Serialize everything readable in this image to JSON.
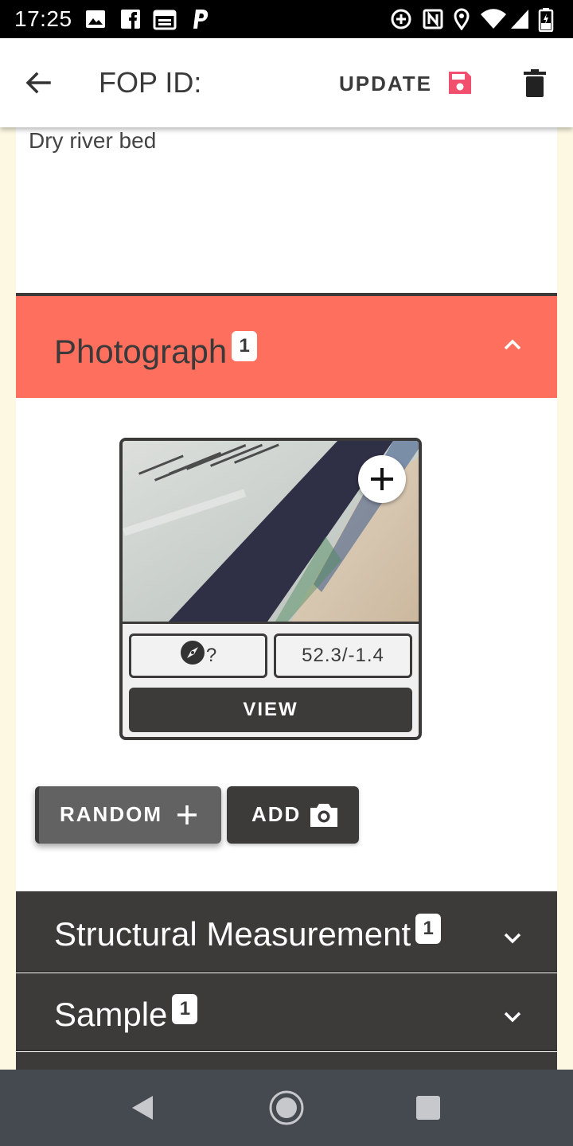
{
  "status_bar": {
    "time": "17:25",
    "left_icons": [
      "image-icon",
      "facebook-icon",
      "calendar-icon",
      "parking-icon"
    ],
    "right_icons": [
      "data-saver-icon",
      "nfc-icon",
      "location-icon",
      "wifi-icon",
      "signal-icon",
      "battery-icon"
    ]
  },
  "app_bar": {
    "title": "FOP ID:",
    "update_label": "UPDATE",
    "save_icon": "save-icon",
    "delete_icon": "delete-icon",
    "back_icon": "arrow-back-icon",
    "accent_color": "#f0506e"
  },
  "details": {
    "location_text": "Dry river bed"
  },
  "photograph_section": {
    "title": "Photograph",
    "count": "1",
    "expanded": true,
    "header_color": "#ff6f5e",
    "photo": {
      "direction_label": "?",
      "coordinates": "52.3/-1.4",
      "view_label": "VIEW"
    },
    "random_label": "RANDOM",
    "add_label": "ADD"
  },
  "sections": [
    {
      "title": "Structural Measurement",
      "count": "1",
      "expanded": false
    },
    {
      "title": "Sample",
      "count": "1",
      "expanded": false
    }
  ],
  "nav_bar": {
    "icons": [
      "back-triangle-icon",
      "home-circle-icon",
      "recents-square-icon"
    ]
  }
}
